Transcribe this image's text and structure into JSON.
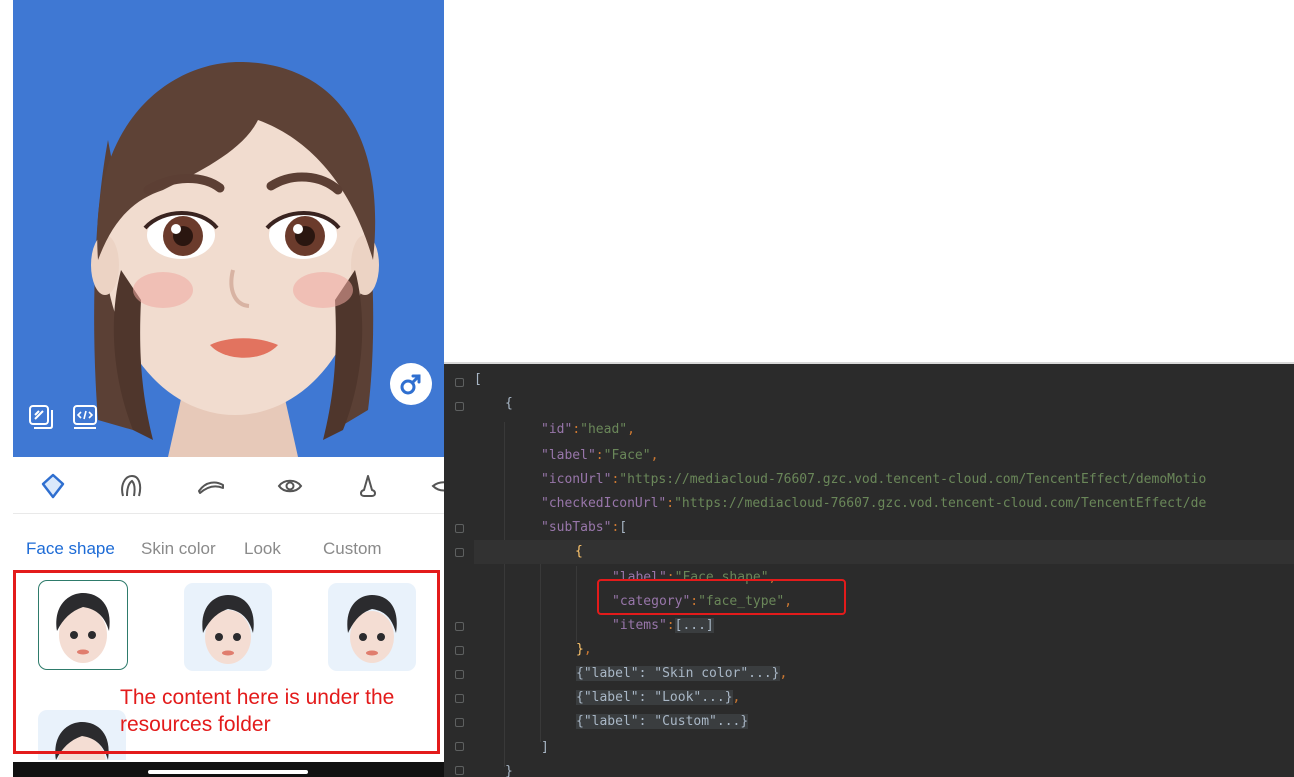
{
  "phone": {
    "category_icons": [
      "face-shape-icon",
      "hair-icon",
      "eyebrow-icon",
      "eye-icon",
      "nose-icon",
      "mouth-icon"
    ],
    "subtabs": [
      "Face shape",
      "Skin color",
      "Look",
      "Custom"
    ],
    "active_subtab": "Face shape",
    "gender_icon": "male-symbol-icon",
    "colors": {
      "preview_bg": "#3f78d3",
      "active_tab": "#1d6bd6",
      "annotation": "#e31b1b"
    }
  },
  "annotation": {
    "line1": "The content here is under the",
    "line2": "resources folder"
  },
  "code": {
    "l1_open": "[",
    "l2_open": "{",
    "l3_key": "\"id\"",
    "l3_val": "\"head\"",
    "l4_key": "\"label\"",
    "l4_val": "\"Face\"",
    "l5_key": "\"iconUrl\"",
    "l5_val": "\"https://mediacloud-76607.gzc.vod.tencent-cloud.com/TencentEffect/demoMotio",
    "l6_key": "\"checkedIconUrl\"",
    "l6_val": "\"https://mediacloud-76607.gzc.vod.tencent-cloud.com/TencentEffect/de",
    "l7_key": "\"subTabs\"",
    "l7_open": "[",
    "l8_open": "{",
    "l9_key": "\"label\"",
    "l9_val": "\"Face shape\"",
    "l10_key": "\"category\"",
    "l10_val": "\"face_type\"",
    "l11_key": "\"items\"",
    "l11_fold": "[...]",
    "l12_close": "}",
    "l13_text": "{\"label\": \"Skin color\"...}",
    "l14_text": "{\"label\": \"Look\"...}",
    "l15_text": "{\"label\": \"Custom\"...}",
    "l16_close": "]",
    "l17_close": "}"
  }
}
